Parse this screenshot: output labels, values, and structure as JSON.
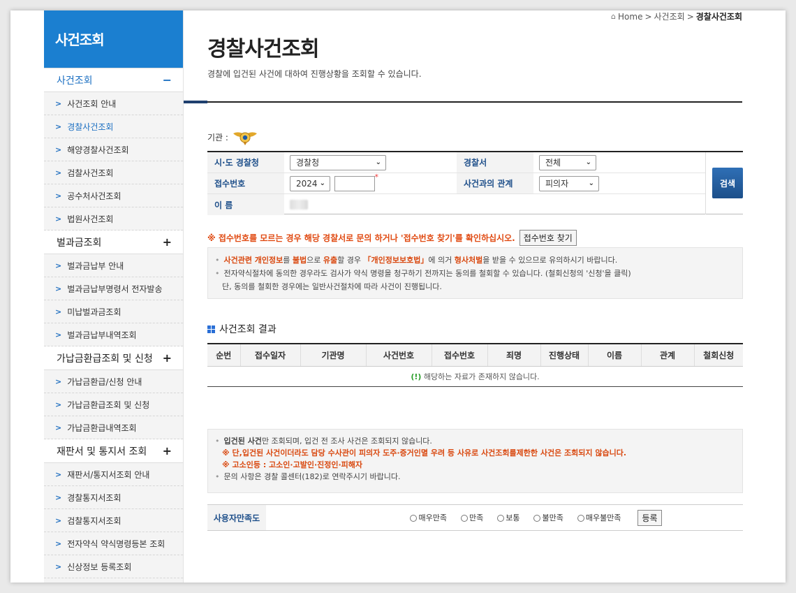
{
  "sidebar": {
    "title": "사건조회",
    "groups": [
      {
        "label": "사건조회",
        "sign": "−",
        "items": [
          "사건조회 안내",
          "경찰사건조회",
          "해양경찰사건조회",
          "검찰사건조회",
          "공수처사건조회",
          "법원사건조회"
        ]
      },
      {
        "label": "벌과금조회",
        "sign": "+",
        "items": [
          "벌과금납부 안내",
          "벌과금납부명령서 전자발송",
          "미납벌과금조회",
          "벌과금납부내역조회"
        ]
      },
      {
        "label": "가납금환급조회 및 신청",
        "sign": "+",
        "items": [
          "가납금환급/신청 안내",
          "가납금환급조회 및 신청",
          "가납금환급내역조회"
        ]
      },
      {
        "label": "재판서 및 통지서 조회",
        "sign": "+",
        "items": [
          "재판서/통지서조회 안내",
          "경찰통지서조회",
          "검찰통지서조회",
          "전자약식 약식명령등본 조회",
          "신상정보 등록조회"
        ]
      }
    ]
  },
  "breadcrumb": {
    "home": "Home",
    "sep": ">",
    "level1": "사건조회",
    "current": "경찰사건조회"
  },
  "page": {
    "title": "경찰사건조회",
    "description": "경찰에 입건된 사건에 대하여 진행상황을 조회할 수 있습니다."
  },
  "agency_label": "기관 :",
  "form": {
    "sido_label": "시·도 경찰청",
    "sido_value": "경찰청",
    "station_label": "경찰서",
    "station_value": "전체",
    "receipt_label": "접수번호",
    "year_value": "2024",
    "required_mark": "*",
    "relation_label": "사건과의 관계",
    "relation_value": "피의자",
    "name_label": "이 름",
    "search_button": "검색"
  },
  "notice": {
    "red_text": "※ 접수번호를 모르는 경우 해당 경찰서로 문의 하거나 '접수번호 찾기'를 확인하십시오.",
    "find_button": "접수번호 찾기",
    "line1": {
      "p1": "사건관련 개인정보",
      "p2": "를 ",
      "p3": "불법",
      "p4": "으로 ",
      "p5": "유출",
      "p6": "할 경우 ",
      "p7": "「개인정보보호법」",
      "p8": "에 의거 ",
      "p9": "형사처벌",
      "p10": "을 받을 수 있으므로 유의하시기 바랍니다."
    },
    "line2": "전자약식절차에 동의한 경우라도 검사가 약식 명령을 청구하기 전까지는 동의를 철회할 수 있습니다. (철회신청의 '신청'을 클릭)",
    "line3": "단, 동의를 철회한 경우에는 일반사건절차에 따라 사건이 진행됩니다."
  },
  "result": {
    "title": "사건조회 결과",
    "columns": [
      "순번",
      "접수일자",
      "기관명",
      "사건번호",
      "접수번호",
      "죄명",
      "진행상태",
      "이름",
      "관계",
      "철회신청"
    ],
    "empty_mark": "(!)",
    "empty_text": " 해당하는 자료가 존재하지 않습니다."
  },
  "info2": {
    "l1_bold": "입건된 사건",
    "l1_rest": "만 조회되며, 입건 전 조사 사건은 조회되지 않습니다.",
    "l2": "※ 단,입건된 사건이더라도 담당 수사관이 피의자 도주·증거인멸 우려 등 사유로 사건조회를제한한 사건은 조회되지 않습니다.",
    "l3": "※ 고소인등 : 고소인·고발인·진정인·피해자",
    "l4": "문의 사항은 경찰 콜센터(182)로 연락주시기 바랍니다."
  },
  "survey": {
    "label": "사용자만족도",
    "options": [
      "매우만족",
      "만족",
      "보통",
      "불만족",
      "매우불만족"
    ],
    "submit": "등록"
  },
  "colors": {
    "sidebar_head": "#1b7fd0",
    "accent_red": "#e04a12",
    "label_blue": "#1e4f8a",
    "search_btn": "#1c4f8a"
  }
}
